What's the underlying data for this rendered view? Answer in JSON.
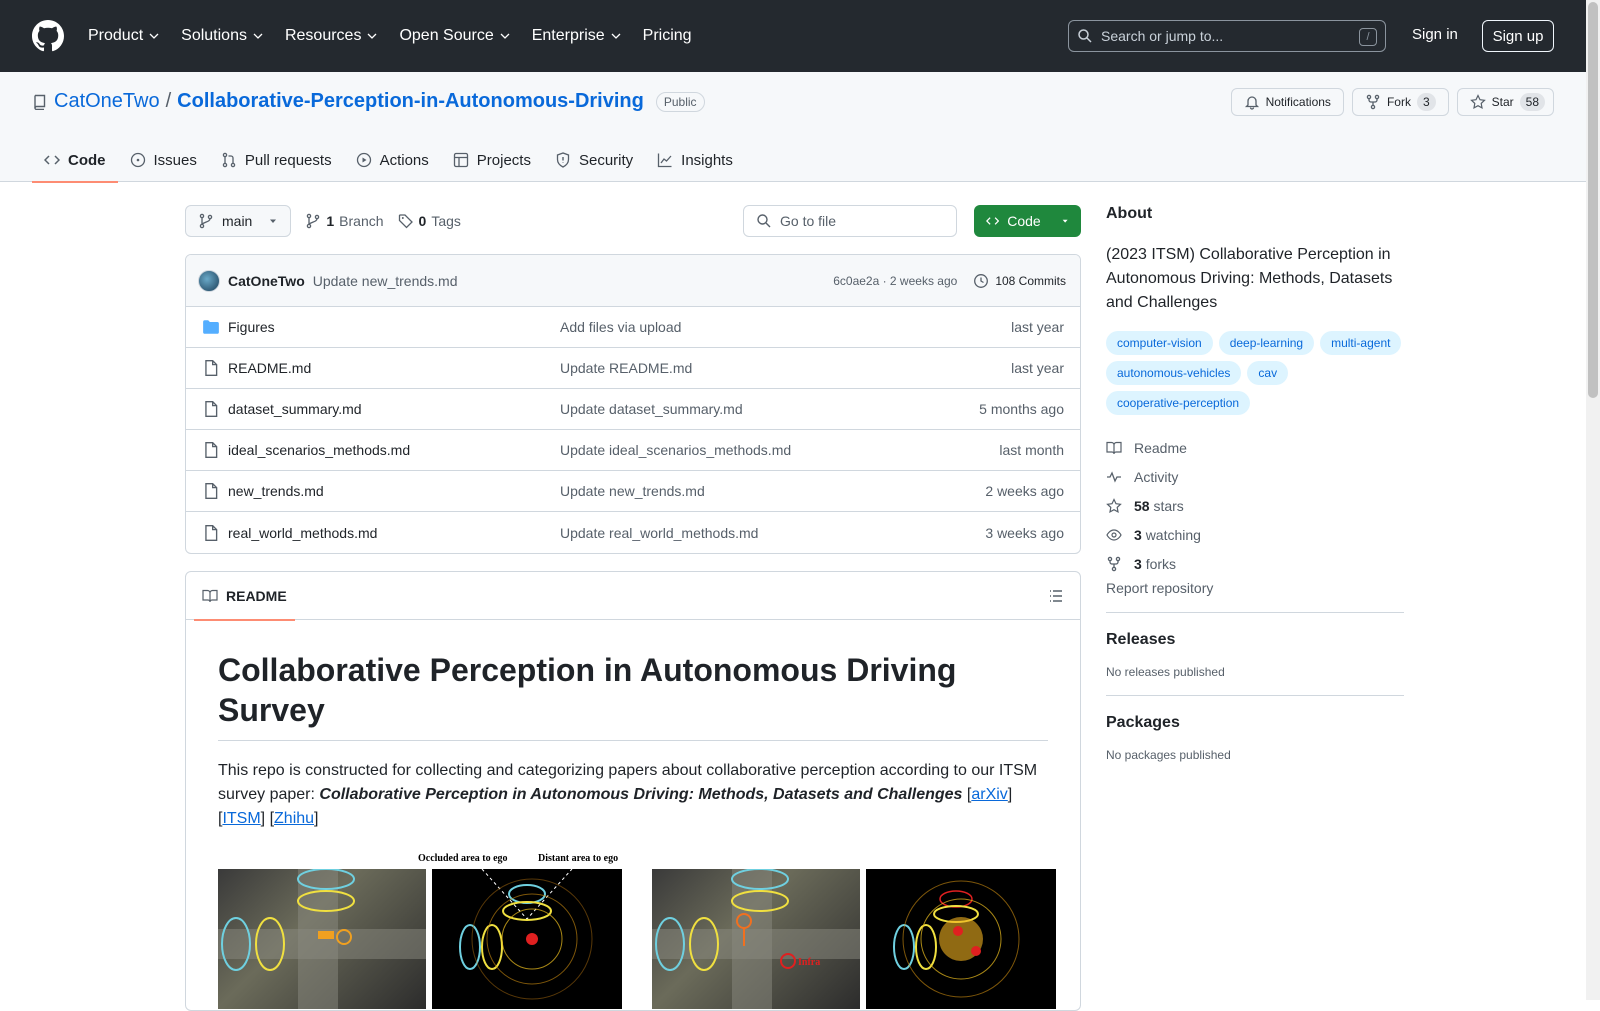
{
  "header": {
    "nav": [
      "Product",
      "Solutions",
      "Resources",
      "Open Source",
      "Enterprise",
      "Pricing"
    ],
    "search_placeholder": "Search or jump to...",
    "search_shortcut": "/",
    "signin": "Sign in",
    "signup": "Sign up"
  },
  "repo": {
    "owner": "CatOneTwo",
    "separator": "/",
    "name": "Collaborative-Perception-in-Autonomous-Driving",
    "visibility": "Public",
    "notifications_label": "Notifications",
    "fork_label": "Fork",
    "fork_count": "3",
    "star_label": "Star",
    "star_count": "58",
    "tabs": [
      {
        "label": "Code",
        "icon": "code-icon"
      },
      {
        "label": "Issues",
        "icon": "issue-icon"
      },
      {
        "label": "Pull requests",
        "icon": "pull-request-icon"
      },
      {
        "label": "Actions",
        "icon": "play-icon"
      },
      {
        "label": "Projects",
        "icon": "table-icon"
      },
      {
        "label": "Security",
        "icon": "shield-icon"
      },
      {
        "label": "Insights",
        "icon": "graph-icon"
      }
    ]
  },
  "toolbar": {
    "branch": "main",
    "branch_count": "1",
    "branch_label": "Branch",
    "tag_count": "0",
    "tag_label": "Tags",
    "goto_placeholder": "Go to file",
    "code_label": "Code"
  },
  "commit": {
    "author": "CatOneTwo",
    "message": "Update new_trends.md",
    "sha_time": "6c0ae2a · 2 weeks ago",
    "commit_count": "108 Commits"
  },
  "files": [
    {
      "name": "Figures",
      "type": "folder",
      "message": "Add files via upload",
      "date": "last year"
    },
    {
      "name": "README.md",
      "type": "file",
      "message": "Update README.md",
      "date": "last year"
    },
    {
      "name": "dataset_summary.md",
      "type": "file",
      "message": "Update dataset_summary.md",
      "date": "5 months ago"
    },
    {
      "name": "ideal_scenarios_methods.md",
      "type": "file",
      "message": "Update ideal_scenarios_methods.md",
      "date": "last month"
    },
    {
      "name": "new_trends.md",
      "type": "file",
      "message": "Update new_trends.md",
      "date": "2 weeks ago"
    },
    {
      "name": "real_world_methods.md",
      "type": "file",
      "message": "Update real_world_methods.md",
      "date": "3 weeks ago"
    }
  ],
  "readme": {
    "tab_label": "README",
    "title": "Collaborative Perception in Autonomous Driving Survey",
    "intro": "This repo is constructed for collecting and categorizing papers about collaborative perception according to our ITSM survey paper: ",
    "paper_title": "Collaborative Perception in Autonomous Driving: Methods, Datasets and Challenges",
    "links": [
      "arXiv",
      "ITSM",
      "Zhihu"
    ],
    "figure_captions": [
      "Occluded area to ego",
      "Distant area to ego"
    ],
    "figure_infra_label": "Infra"
  },
  "sidebar": {
    "about_title": "About",
    "description": "(2023 ITSM) Collaborative Perception in Autonomous Driving: Methods, Datasets and Challenges",
    "topics": [
      "computer-vision",
      "deep-learning",
      "multi-agent",
      "autonomous-vehicles",
      "cav",
      "cooperative-perception"
    ],
    "links": [
      {
        "icon": "book-icon",
        "count": "",
        "label": "Readme"
      },
      {
        "icon": "pulse-icon",
        "count": "",
        "label": "Activity"
      },
      {
        "icon": "star-icon",
        "count": "58",
        "label": "stars"
      },
      {
        "icon": "eye-icon",
        "count": "3",
        "label": "watching"
      },
      {
        "icon": "fork-icon",
        "count": "3",
        "label": "forks"
      }
    ],
    "report": "Report repository",
    "releases_title": "Releases",
    "releases_text": "No releases published",
    "packages_title": "Packages",
    "packages_text": "No packages published"
  },
  "colors": {
    "header_bg": "#24292f",
    "link": "#0969da",
    "primary_button": "#1f883d",
    "active_tab_underline": "#fd8c73",
    "topic_bg": "#ddf4ff"
  }
}
